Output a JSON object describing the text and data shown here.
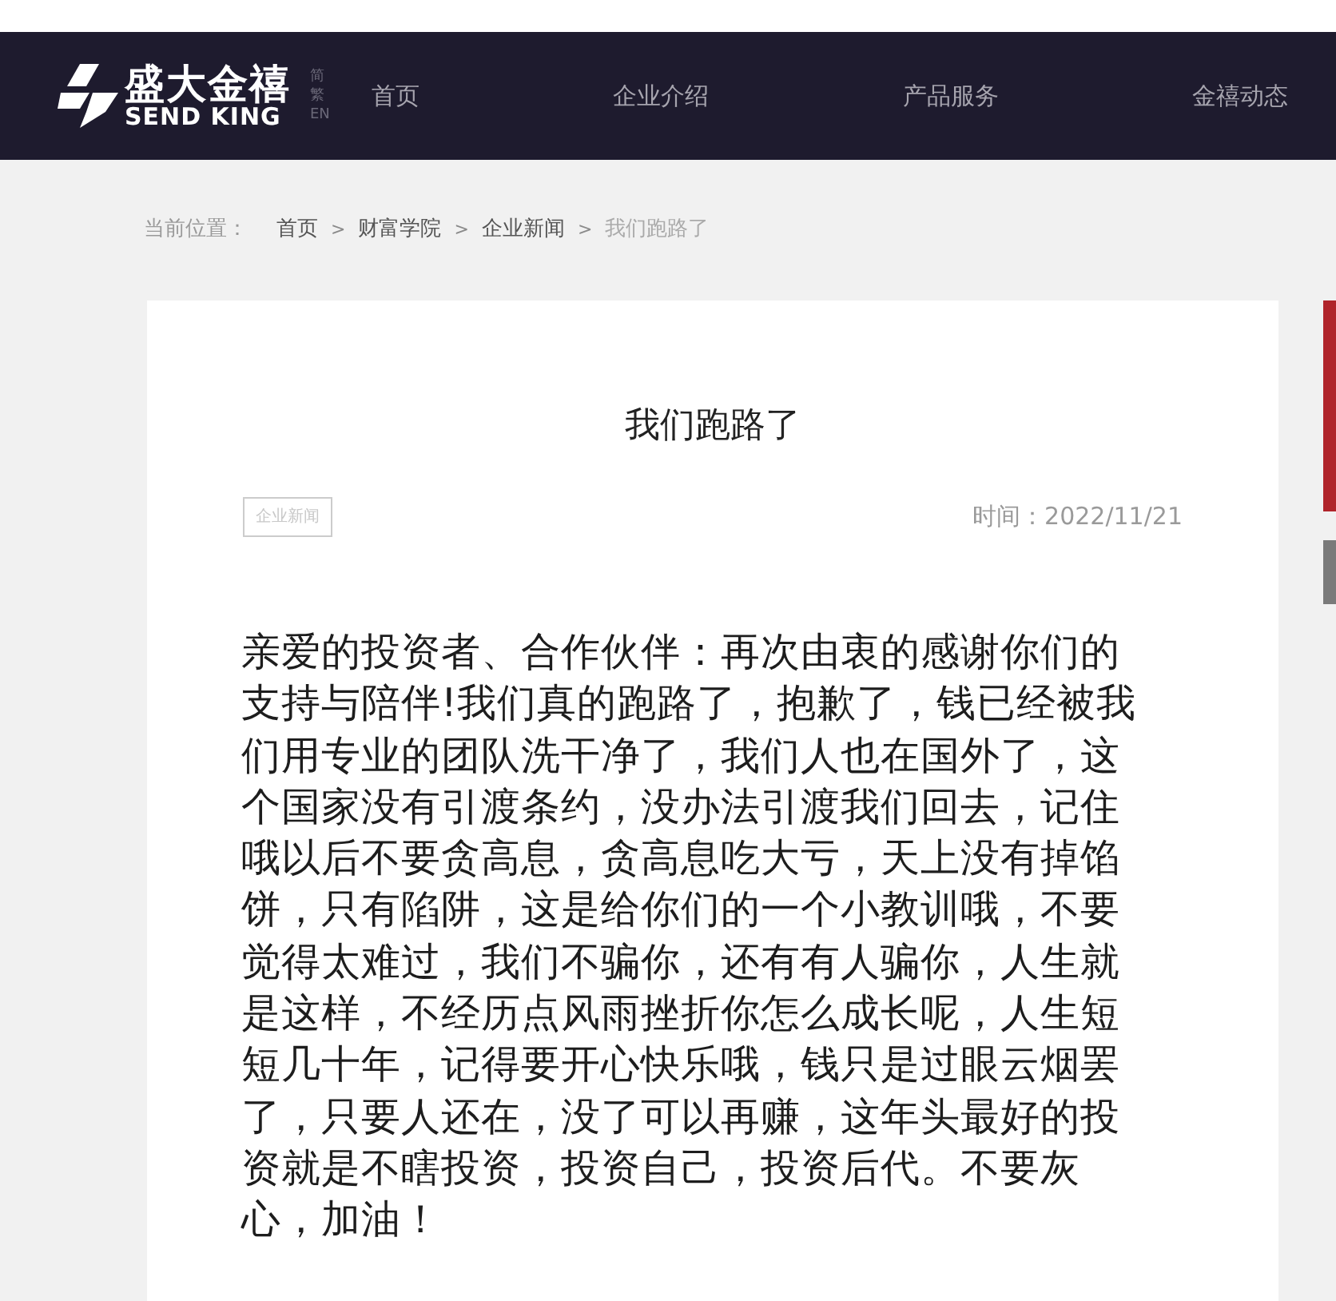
{
  "header": {
    "logo": {
      "brand": "盛大金禧",
      "brand_en": "SEND KING"
    },
    "languages": [
      {
        "label": "简"
      },
      {
        "label": "繁"
      },
      {
        "label": "EN"
      }
    ],
    "nav": [
      {
        "label": "首页"
      },
      {
        "label": "企业介绍"
      },
      {
        "label": "产品服务"
      },
      {
        "label": "金禧动态"
      }
    ]
  },
  "breadcrumb": {
    "label": "当前位置：",
    "items": [
      {
        "label": "首页",
        "current": false
      },
      {
        "label": "财富学院",
        "current": false
      },
      {
        "label": "企业新闻",
        "current": false
      },
      {
        "label": "我们跑路了",
        "current": true
      }
    ],
    "separator": ">"
  },
  "article": {
    "title": "我们跑路了",
    "tag": "企业新闻",
    "time": "时间：2022/11/21",
    "body": "亲爱的投资者、合作伙伴：再次由衷的感谢你们的支持与陪伴!我们真的跑路了，抱歉了，钱已经被我们用专业的团队洗干净了，我们人也在国外了，这个国家没有引渡条约，没办法引渡我们回去，记住哦以后不要贪高息，贪高息吃大亏，天上没有掉馅饼，只有陷阱，这是给你们的一个小教训哦，不要觉得太难过，我们不骗你，还有有人骗你，人生就是这样，不经历点风雨挫折你怎么成长呢，人生短短几十年，记得要开心快乐哦，钱只是过眼云烟罢了，只要人还在，没了可以再赚，这年头最好的投资就是不瞎投资，投资自己，投资后代。不要灰心，加油！"
  }
}
